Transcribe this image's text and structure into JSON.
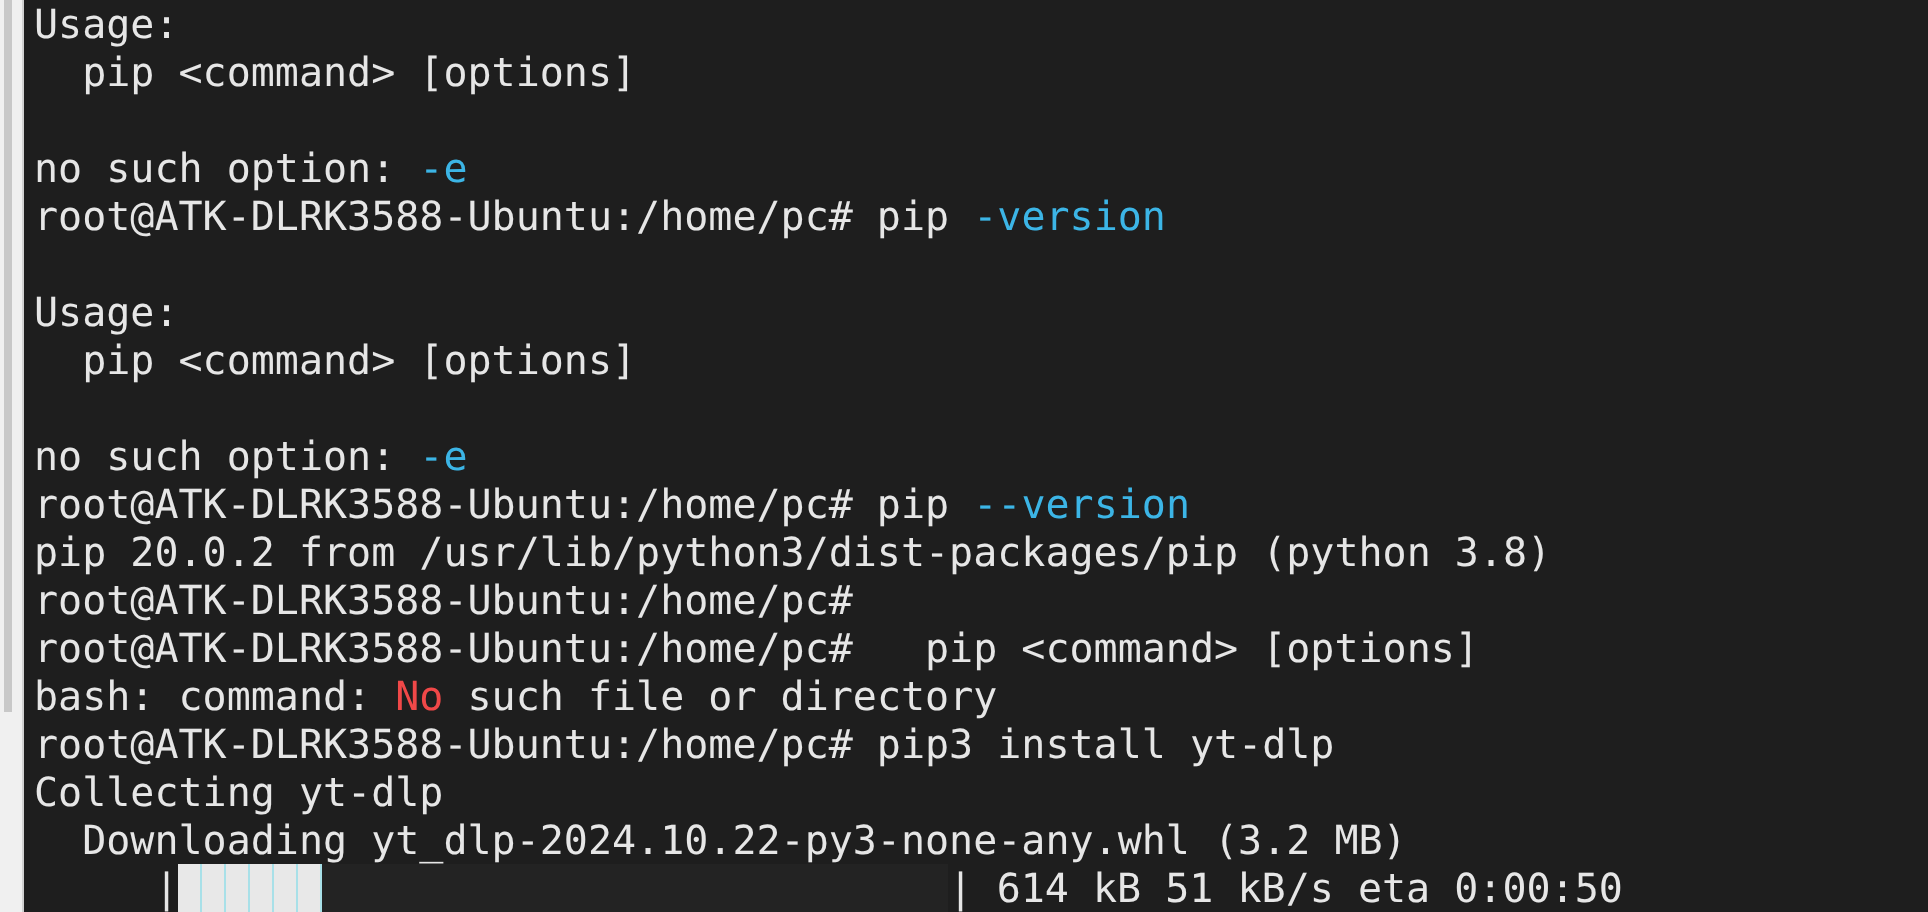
{
  "terminal": {
    "blocks": [
      {
        "lines": [
          {
            "segments": [
              {
                "kind": "plain",
                "text": "Usage:"
              }
            ]
          },
          {
            "segments": [
              {
                "kind": "plain",
                "text": "  pip <command> [options]"
              }
            ]
          }
        ]
      },
      {
        "lines": [
          {
            "segments": [
              {
                "kind": "plain",
                "text": "no such option: "
              },
              {
                "kind": "option",
                "text": "-e"
              }
            ]
          },
          {
            "segments": [
              {
                "kind": "plain",
                "text": "root@ATK-DLRK3588-Ubuntu:/home/pc# pip "
              },
              {
                "kind": "option",
                "text": "-version"
              }
            ]
          }
        ]
      },
      {
        "lines": [
          {
            "segments": [
              {
                "kind": "plain",
                "text": "Usage:"
              }
            ]
          },
          {
            "segments": [
              {
                "kind": "plain",
                "text": "  pip <command> [options]"
              }
            ]
          }
        ]
      },
      {
        "lines": [
          {
            "segments": [
              {
                "kind": "plain",
                "text": "no such option: "
              },
              {
                "kind": "option",
                "text": "-e"
              }
            ]
          },
          {
            "segments": [
              {
                "kind": "plain",
                "text": "root@ATK-DLRK3588-Ubuntu:/home/pc# pip "
              },
              {
                "kind": "option",
                "text": "--version"
              }
            ]
          },
          {
            "segments": [
              {
                "kind": "plain",
                "text": "pip 20.0.2 from /usr/lib/python3/dist-packages/pip (python 3.8)"
              }
            ]
          },
          {
            "segments": [
              {
                "kind": "plain",
                "text": "root@ATK-DLRK3588-Ubuntu:/home/pc#"
              }
            ]
          },
          {
            "segments": [
              {
                "kind": "plain",
                "text": "root@ATK-DLRK3588-Ubuntu:/home/pc#   pip <command> [options]"
              }
            ]
          },
          {
            "segments": [
              {
                "kind": "plain",
                "text": "bash: command: "
              },
              {
                "kind": "error",
                "text": "No"
              },
              {
                "kind": "plain",
                "text": " such file or directory"
              }
            ]
          },
          {
            "segments": [
              {
                "kind": "plain",
                "text": "root@ATK-DLRK3588-Ubuntu:/home/pc# pip3 install yt-dlp"
              }
            ]
          },
          {
            "segments": [
              {
                "kind": "plain",
                "text": "Collecting yt-dlp"
              }
            ]
          },
          {
            "segments": [
              {
                "kind": "plain",
                "text": "  Downloading yt_dlp-2024.10.22-py3-none-any.whl (3.2 MB)"
              }
            ]
          }
        ]
      }
    ],
    "progress": {
      "left": "     |",
      "level": 0.1875,
      "right": "|",
      "reading": " 614 kB 51 kB/s eta 0:00:50"
    }
  }
}
